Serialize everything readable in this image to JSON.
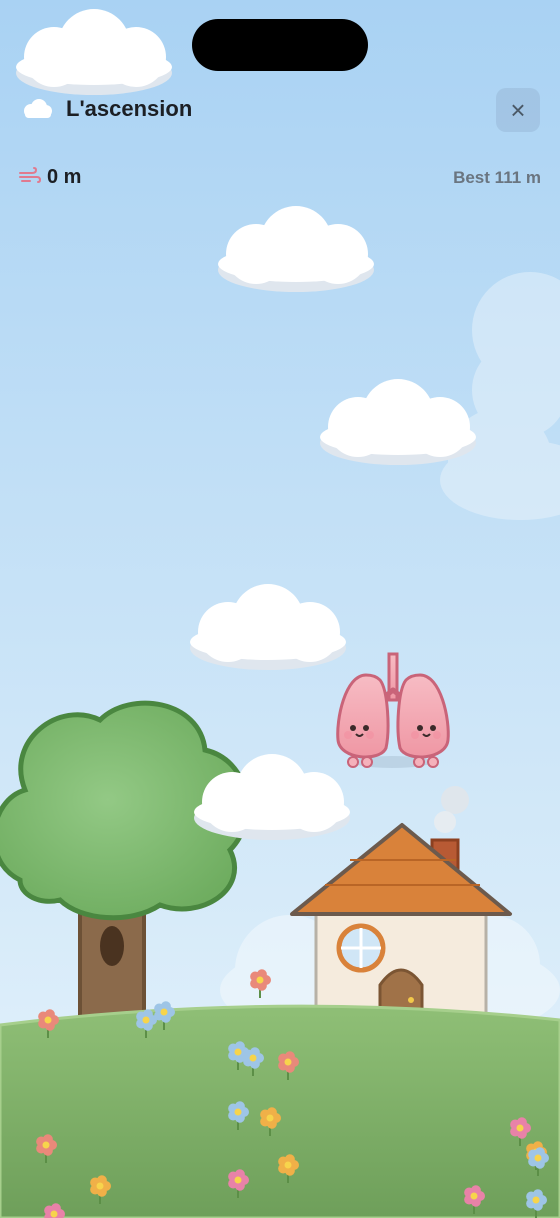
{
  "header": {
    "title": "L'ascension",
    "title_icon": "cloud-icon",
    "close_icon": "close-icon",
    "close_label": "×"
  },
  "stats": {
    "height_icon": "wind-icon",
    "height_value": "0 m",
    "best_label": "Best",
    "best_value": "111 m"
  },
  "colors": {
    "sky_top": "#a9d2f3",
    "sky_bottom": "#e4f2fb",
    "grass": "#7eb068",
    "tree_leaves": "#7cb96c",
    "tree_outline": "#4a8740",
    "roof": "#d9823a",
    "lung_pink": "#f2a7b1",
    "lung_outline": "#c96479"
  },
  "scene": {
    "character": "lungs-character",
    "platforms": [
      "cloud",
      "cloud",
      "cloud",
      "cloud"
    ],
    "decor": [
      "tree",
      "house",
      "flowers",
      "hill"
    ]
  }
}
